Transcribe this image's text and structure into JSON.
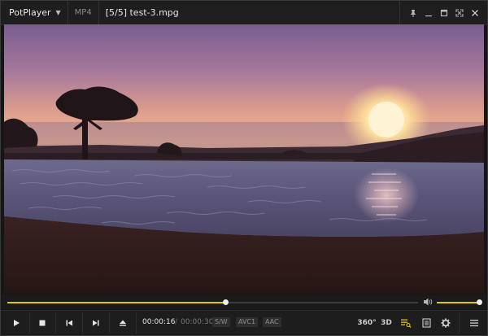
{
  "titlebar": {
    "app_name": "PotPlayer",
    "format": "MP4",
    "file_title": "[5/5] test-3.mpg"
  },
  "icons": {
    "menu_caret": "chevron-down-icon",
    "pin": "pin-icon",
    "minimize": "minimize-icon",
    "maximize": "maximize-icon",
    "fullscreen": "fullscreen-icon",
    "close": "close-icon",
    "play": "play-icon",
    "stop": "stop-icon",
    "previous": "previous-icon",
    "next": "next-icon",
    "eject": "eject-icon",
    "volume": "volume-icon",
    "playlist": "playlist-icon",
    "chapters": "chapters-icon",
    "settings": "gear-icon",
    "menu": "hamburger-icon"
  },
  "playback": {
    "current_time": "00:00:16",
    "separator": "/",
    "total_time": "00:00:30",
    "progress_fraction": 0.53,
    "volume_fraction": 1.0
  },
  "badges": {
    "decoder": "S/W",
    "video_codec": "AVC1",
    "audio_codec": "AAC"
  },
  "right_controls": {
    "vr_label": "360°",
    "stereo_label": "3D"
  },
  "colors": {
    "accent": "#e6c700",
    "background": "#1d1d1d"
  }
}
